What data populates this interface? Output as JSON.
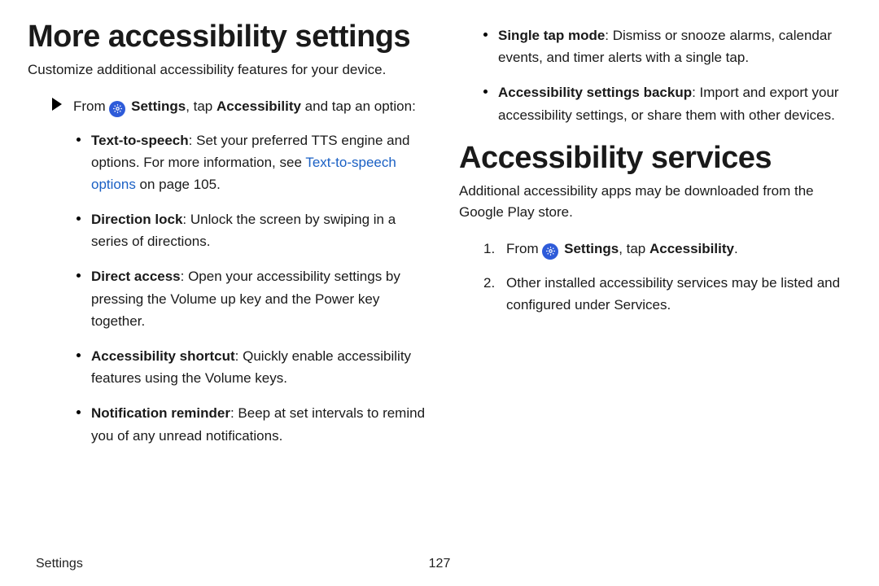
{
  "left": {
    "h1": "More accessibility settings",
    "intro": "Customize additional accessibility features for your device.",
    "from_prefix": "From ",
    "settings_bold": "Settings",
    "from_mid": ", tap ",
    "accessibility_bold": "Accessibility",
    "from_suffix": " and tap an option:",
    "items": [
      {
        "term": "Text-to-speech",
        "desc_a": ": Set your preferred TTS engine and options. For more information, see ",
        "link": "Text-to-speech options",
        "desc_b": " on page 105."
      },
      {
        "term": "Direction lock",
        "desc": ": Unlock the screen by swiping in a series of directions."
      },
      {
        "term": "Direct access",
        "desc": ": Open your accessibility settings by pressing the Volume up key and the Power key together."
      },
      {
        "term": "Accessibility shortcut",
        "desc": ": Quickly enable accessibility features using the Volume keys."
      },
      {
        "term": "Notification reminder",
        "desc": ": Beep at set intervals to remind you of any unread notifications."
      }
    ]
  },
  "right": {
    "cont_items": [
      {
        "term": "Single tap mode",
        "desc": ": Dismiss or snooze alarms, calendar events, and timer alerts with a single tap."
      },
      {
        "term": "Accessibility settings backup",
        "desc": ": Import and export your accessibility settings, or share them with other devices."
      }
    ],
    "h1": "Accessibility services",
    "intro": "Additional accessibility apps may be downloaded from the Google Play store.",
    "step1_prefix": "From ",
    "step1_settings": "Settings",
    "step1_mid": ", tap ",
    "step1_accessibility": "Accessibility",
    "step1_suffix": ".",
    "step2": "Other installed accessibility services may be listed and configured under Services."
  },
  "footer": {
    "section": "Settings",
    "page": "127"
  }
}
